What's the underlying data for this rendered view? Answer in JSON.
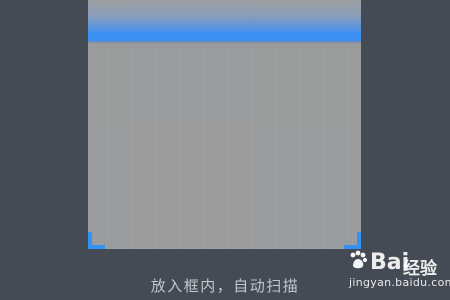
{
  "scanner": {
    "instruction": "放入框内，自动扫描"
  },
  "watermark": {
    "brand_latin": "Bai",
    "brand_cn": "经验",
    "domain": "jingyan.baidu.com"
  },
  "icons": {
    "watermark": "paw-logo-icon"
  },
  "colors": {
    "background": "#454b55",
    "frame": "#9d9e9f",
    "accent": "#3b90f4",
    "instruction_text": "#c4c6ca"
  }
}
